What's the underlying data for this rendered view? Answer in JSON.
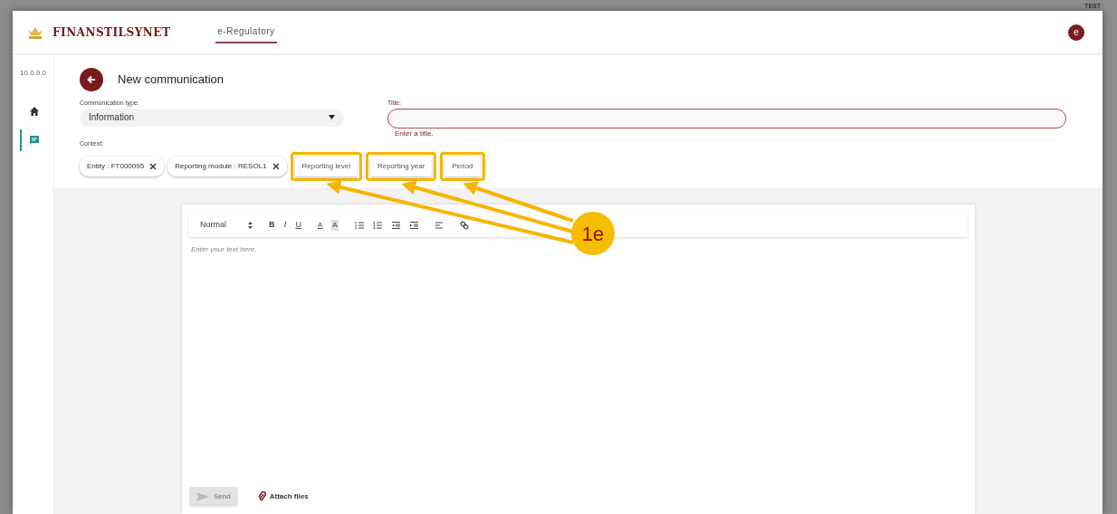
{
  "header": {
    "brand": "FINANSTILSYNET",
    "tabs": [
      {
        "label": "e-Regulatory",
        "selected": true
      }
    ],
    "avatar": "e",
    "environment": "TEST"
  },
  "sidebar": {
    "version": "10.0.9.0",
    "items": [
      {
        "kind": "home",
        "selected": false
      },
      {
        "kind": "messages",
        "selected": true
      }
    ]
  },
  "page": {
    "title": "New communication"
  },
  "form": {
    "communication_type": {
      "label": "Communication type:",
      "value": "Information"
    },
    "title": {
      "label": "Title:",
      "invalid": true,
      "error": "Enter a title."
    },
    "context": {
      "label": "Context:",
      "chips": [
        {
          "label": "Entity : FT000095",
          "removable": true,
          "highlighted": false
        },
        {
          "label": "Reporting module : RESOL1",
          "removable": true,
          "highlighted": false
        },
        {
          "label": "Reporting level",
          "removable": false,
          "highlighted": true
        },
        {
          "label": "Reporting year",
          "removable": false,
          "highlighted": true
        },
        {
          "label": "Period",
          "removable": false,
          "highlighted": true
        }
      ]
    }
  },
  "editor": {
    "toolbar": [
      {
        "kind": "select",
        "label": "Normal"
      },
      {
        "kind": "bold",
        "label": "B"
      },
      {
        "kind": "italic",
        "label": "I"
      },
      {
        "kind": "underline",
        "label": "U"
      },
      {
        "kind": "color",
        "label": "A"
      },
      {
        "kind": "background",
        "label": "A"
      },
      {
        "kind": "ordered-list"
      },
      {
        "kind": "bullet-list"
      },
      {
        "kind": "outdent"
      },
      {
        "kind": "indent"
      },
      {
        "kind": "align"
      },
      {
        "kind": "link"
      }
    ],
    "placeholder": "Enter your text here.",
    "send": {
      "label": "Send",
      "disabled": true
    },
    "attach": {
      "label": "Attach files"
    }
  },
  "annotation": {
    "callout": "1e"
  }
}
